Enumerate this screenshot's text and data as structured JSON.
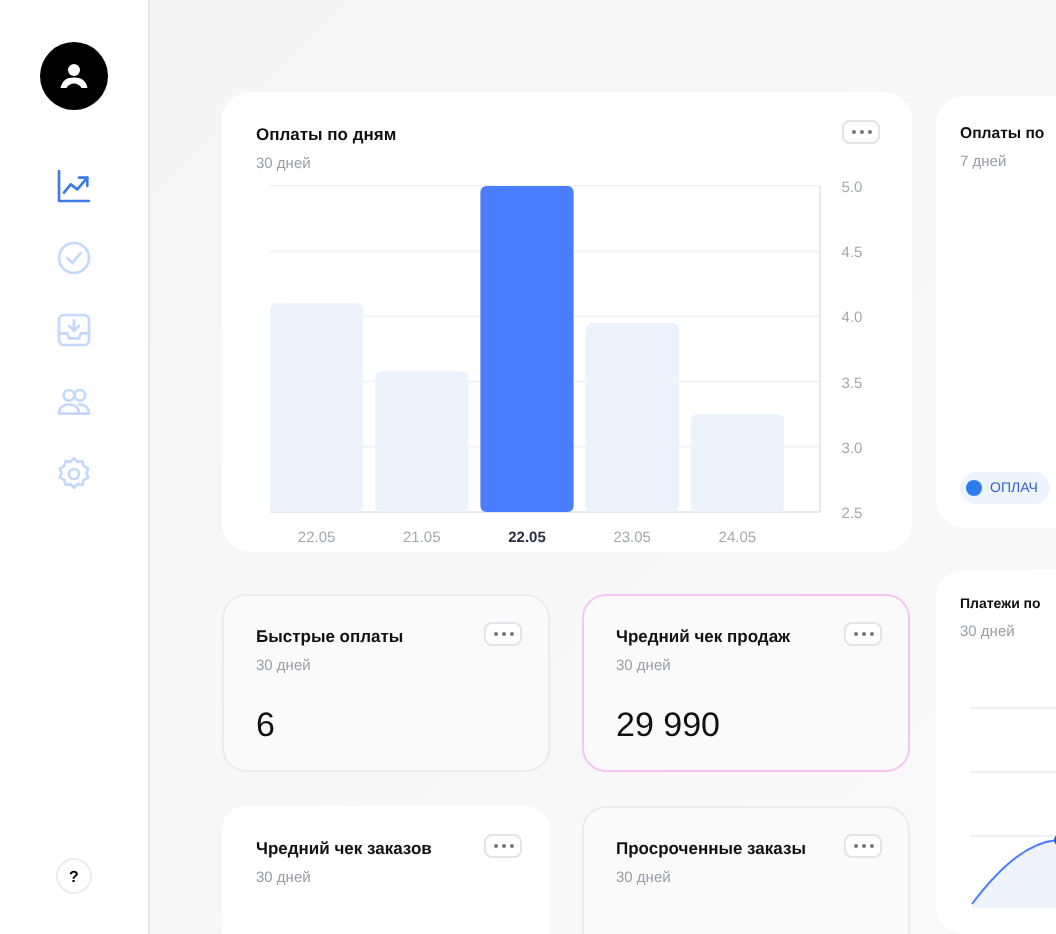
{
  "sidebar": {
    "nav_items": [
      {
        "kind": "chart",
        "selected": true
      },
      {
        "kind": "check",
        "selected": false
      },
      {
        "kind": "inbox",
        "selected": false
      },
      {
        "kind": "users",
        "selected": false
      },
      {
        "kind": "settings",
        "selected": false
      }
    ],
    "help": "?"
  },
  "payments_chart": {
    "title": "Оплаты по дням",
    "subtitle": "30 дней",
    "chart_data": {
      "type": "bar",
      "stacked": true,
      "categories": [
        "22.05",
        "21.05",
        "22.05",
        "23.05",
        "24.05"
      ],
      "ylim": [
        2.5,
        5.0
      ],
      "grid": true,
      "yticks": [
        2.5,
        {
          "value": 3,
          "label": "3.0"
        },
        3.5,
        {
          "value": 4,
          "label": "4.0"
        },
        4.5,
        {
          "value": 5,
          "label": "5.0"
        }
      ],
      "series": [
        {
          "color": "#edf3fd",
          "values": [
            4.1,
            3.58,
            null,
            3.95,
            3.25
          ]
        },
        {
          "color": "#4a7dff",
          "values": [
            null,
            null,
            5.0,
            null,
            null
          ]
        }
      ]
    }
  },
  "stat_cards": [
    {
      "title": "Быстрые оплаты",
      "subtitle": "30 дней",
      "value": "6",
      "selected": false,
      "highlighted": false
    },
    {
      "title": "Чредний чек продаж",
      "subtitle": "30 дней",
      "value": "29 990",
      "selected": true,
      "highlighted": false
    },
    {
      "title": "Чредний чек заказов",
      "subtitle": "30 дней",
      "selected": false,
      "highlighted": true
    },
    {
      "title": "Просроченные заказы",
      "subtitle": "30 дней",
      "selected": false,
      "highlighted": false
    }
  ],
  "side_cards": [
    {
      "kind": "legend",
      "title": "Оплаты по",
      "subtitle": "7 дней",
      "legend": {
        "label": "ОПЛАЧ",
        "color": "#2f7bf0"
      }
    },
    {
      "kind": "line",
      "title": "Платежи по",
      "subtitle": "30 дней"
    }
  ]
}
